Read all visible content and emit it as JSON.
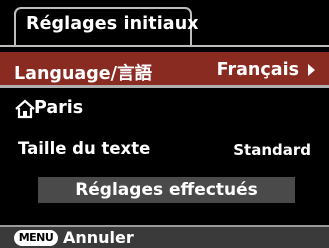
{
  "title": "Réglages initiaux",
  "language_row": {
    "label": "Language/言語",
    "value": "Français",
    "selected_color": "#8a2b22",
    "arrow_icon": "triangle-right-icon"
  },
  "home_city": {
    "icon": "home-icon",
    "name": "Paris"
  },
  "text_size": {
    "label": "Taille du texte",
    "value": "Standard"
  },
  "confirm_button": {
    "label": "Réglages effectués"
  },
  "footer": {
    "menu_key": "MENU",
    "cancel_label": "Annuler"
  }
}
